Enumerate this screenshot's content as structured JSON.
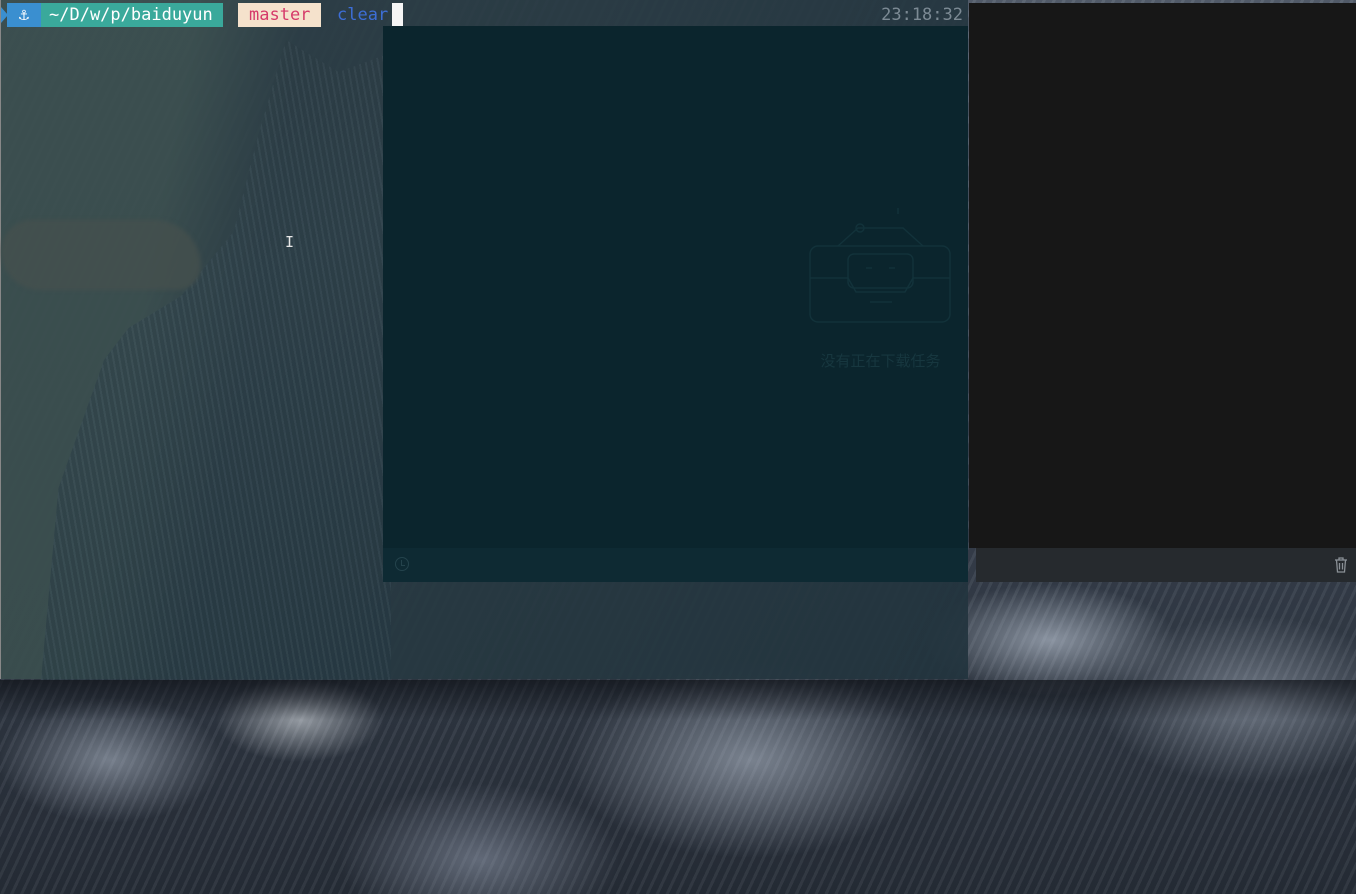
{
  "terminal": {
    "prompt": {
      "anchor_icon": "anchor-icon",
      "anchor_glyph": "⚓",
      "path": "~/D/w/p/baiduyun",
      "branch": "master",
      "command": "clear",
      "time": "23:18:32"
    },
    "colors": {
      "anchor_bg": "#3a8fd0",
      "path_bg": "#3aa99b",
      "branch_bg": "#f5e2cc",
      "branch_fg": "#d63a6a",
      "command_fg": "#3d6ed6"
    }
  },
  "download_manager": {
    "empty_message": "没有正在下载任务",
    "empty_icon": "empty-inbox-icon",
    "footer_icon": "history-icon"
  },
  "side_panel": {
    "footer_icon": "trash-icon"
  }
}
